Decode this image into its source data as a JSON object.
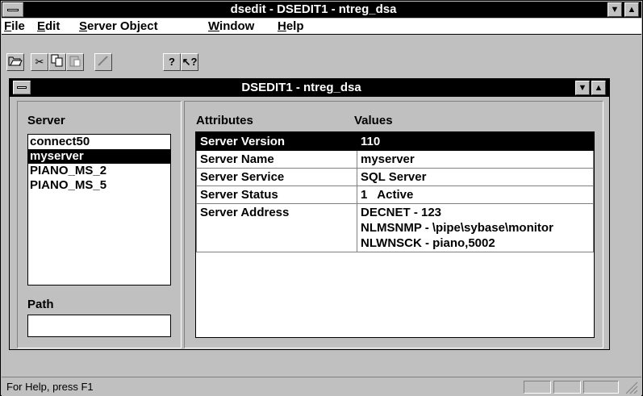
{
  "window": {
    "title": "dsedit - DSEDIT1 - ntreg_dsa"
  },
  "menu": {
    "items": [
      {
        "label": "File",
        "underline": "F"
      },
      {
        "label": "Edit",
        "underline": "E"
      },
      {
        "label": "Server Object",
        "underline": "S"
      },
      {
        "label": "Window",
        "underline": "W"
      },
      {
        "label": "Help",
        "underline": "H"
      }
    ]
  },
  "toolbar": {
    "buttons": [
      "open-icon",
      "cut-icon",
      "copy-icon",
      "paste-icon",
      "wand-icon",
      "help-icon",
      "context-help-icon"
    ]
  },
  "child": {
    "title": "DSEDIT1 - ntreg_dsa",
    "server_label": "Server",
    "servers": [
      "connect50",
      "myserver",
      "PIANO_MS_2",
      "PIANO_MS_5"
    ],
    "selected_server": "myserver",
    "path_label": "Path",
    "path_value": "",
    "attributes_header": "Attributes",
    "values_header": "Values",
    "rows": [
      {
        "attr": "Server Version",
        "value": [
          "110"
        ]
      },
      {
        "attr": "Server Name",
        "value": [
          "myserver"
        ]
      },
      {
        "attr": "Server Service",
        "value": [
          "SQL Server"
        ]
      },
      {
        "attr": "Server Status",
        "value": [
          "1   Active"
        ]
      },
      {
        "attr": "Server Address",
        "value": [
          "DECNET - 123",
          "NLMSNMP - \\pipe\\sybase\\monitor",
          "NLWNSCK - piano,5002"
        ]
      }
    ],
    "selected_row": "Server Version"
  },
  "status": {
    "text": "For Help, press F1"
  },
  "colors": {
    "titlebar": "#000000",
    "face": "#c0c0c0",
    "window": "#ffffff",
    "selection": "#000000"
  }
}
